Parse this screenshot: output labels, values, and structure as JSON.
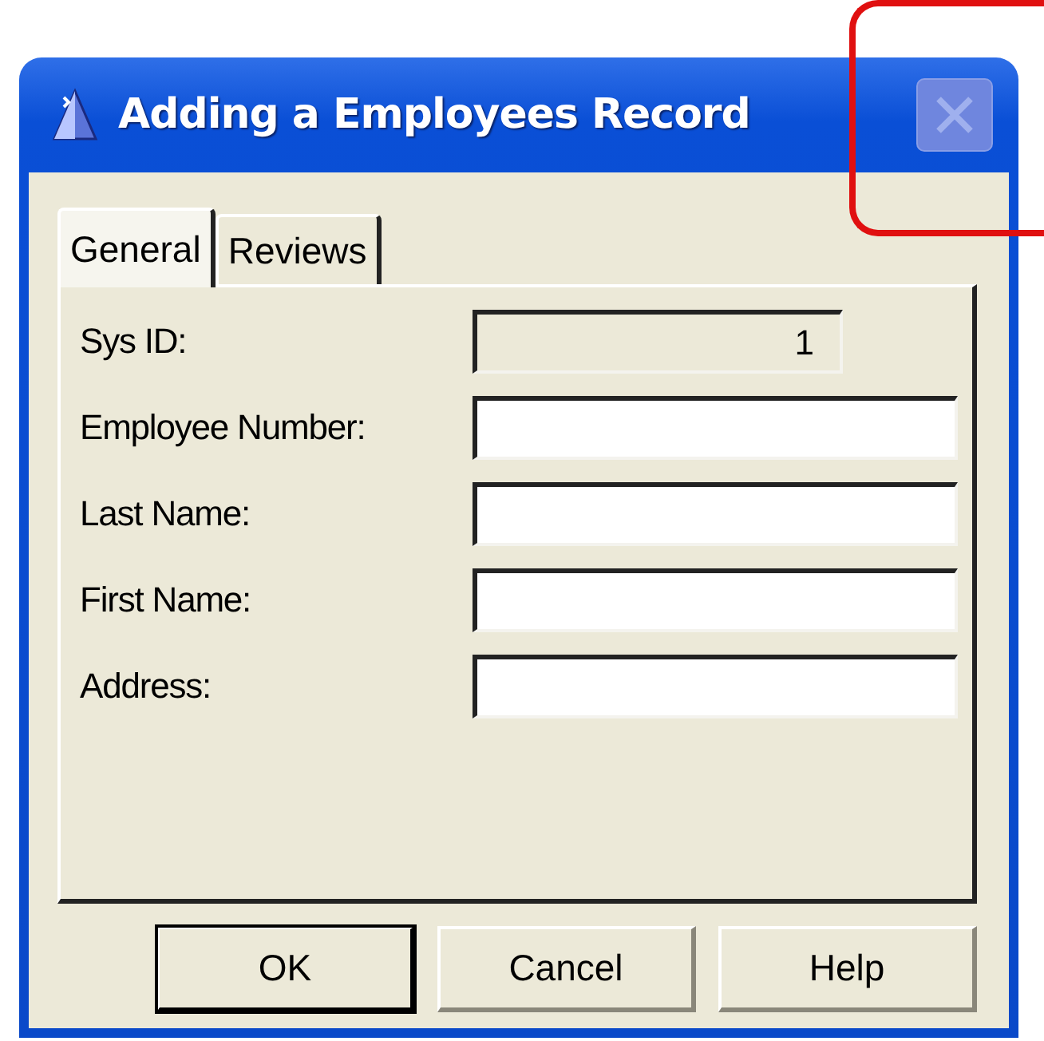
{
  "window": {
    "title": "Adding a Employees Record",
    "close_button": {
      "disabled": true,
      "highlighted": true
    }
  },
  "tabs": [
    {
      "label": "General",
      "selected": true
    },
    {
      "label": "Reviews",
      "selected": false
    }
  ],
  "fields": [
    {
      "label": "Sys ID:",
      "value": "1",
      "disabled": true
    },
    {
      "label": "Employee Number:",
      "disabled": false
    },
    {
      "label": "Last Name:",
      "disabled": false
    },
    {
      "label": "First Name:",
      "disabled": false
    },
    {
      "label": "Address:",
      "disabled": false
    }
  ],
  "buttons": [
    {
      "label": "OK",
      "default": true
    },
    {
      "label": "Cancel",
      "default": false
    },
    {
      "label": "Help",
      "default": false
    }
  ]
}
